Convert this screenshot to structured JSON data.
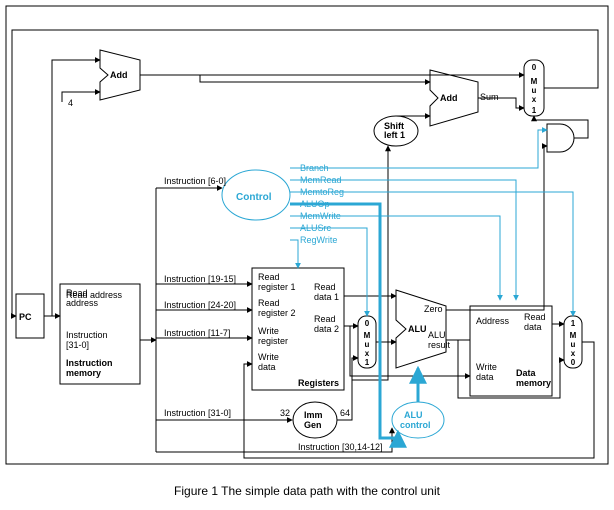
{
  "caption": "Figure 1 The simple data path with the control unit",
  "blocks": {
    "pc": "PC",
    "instr_mem_title": "Instruction\nmemory",
    "instr_mem_in": "Read\naddress",
    "instr_mem_out": "Instruction\n[31-0]",
    "registers_title": "Registers",
    "reg_rr1": "Read\nregister 1",
    "reg_rr2": "Read\nregister 2",
    "reg_wr": "Write\nregister",
    "reg_wd": "Write\ndata",
    "reg_rd1": "Read\ndata 1",
    "reg_rd2": "Read\ndata 2",
    "data_mem_title": "Data\nmemory",
    "dm_addr": "Address",
    "dm_rd": "Read\ndata",
    "dm_wd": "Write\ndata",
    "imm_gen": "Imm\nGen",
    "add1": "Add",
    "add2": "Add",
    "sum_lbl": "Sum",
    "shift_left": "Shift\nleft 1",
    "control": "Control",
    "alu": "ALU",
    "alu_zero": "Zero",
    "alu_result": "ALU\nresult",
    "alu_ctrl": "ALU\ncontrol",
    "mux": "Mux",
    "mux0": "0",
    "mux1": "1"
  },
  "signals": {
    "branch": "Branch",
    "mem_read": "MemRead",
    "mem_to_reg": "MemtoReg",
    "alu_op": "ALUOp",
    "mem_write": "MemWrite",
    "alu_src": "ALUSrc",
    "reg_write": "RegWrite"
  },
  "wires": {
    "instr_6_0": "Instruction [6-0]",
    "instr_19_15": "Instruction [19-15]",
    "instr_24_20": "Instruction [24-20]",
    "instr_11_7": "Instruction [11-7]",
    "instr_31_0": "Instruction [31-0]",
    "instr_30_14_12": "Instruction [30,14-12]",
    "imm_in": "32",
    "imm_out": "64",
    "const4": "4"
  },
  "colors": {
    "control": "#2ba7d4",
    "ink": "#000"
  }
}
